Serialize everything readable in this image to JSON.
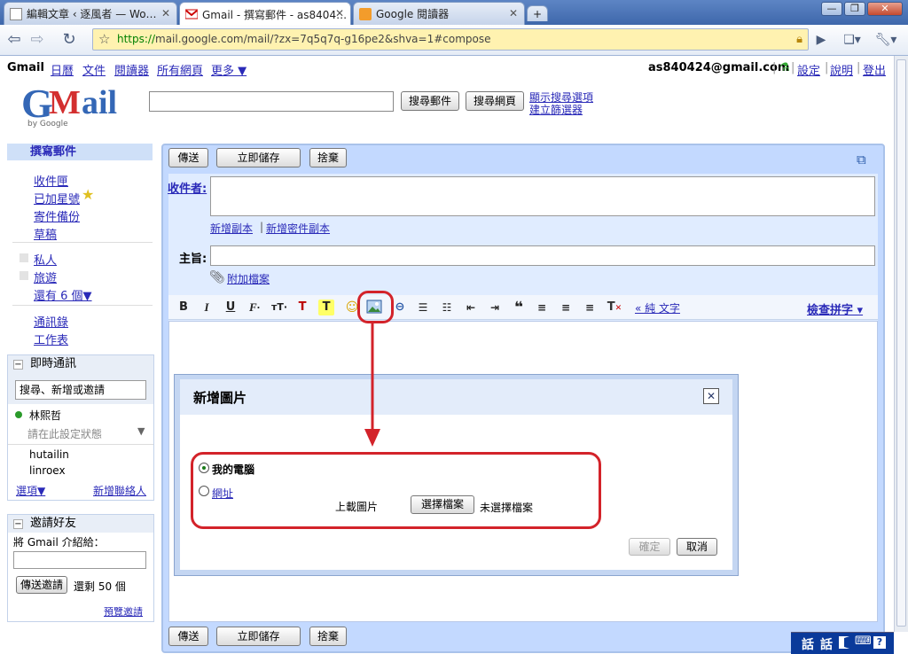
{
  "browser": {
    "tabs": [
      {
        "title": "編輯文章 ‹ 逐風者 — Wo…",
        "active": false
      },
      {
        "title": "Gmail - 撰寫郵件 - as8404…",
        "active": true
      },
      {
        "title": "Google 閱讀器",
        "active": false
      }
    ],
    "new_tab": "+",
    "window_buttons": [
      "—",
      "❐",
      "✕"
    ],
    "url_scheme": "https://",
    "url_rest": "mail.google.com/mail/?zx=7q5q7q-g16pe2&shva=1#compose"
  },
  "gmail": {
    "topnav": [
      "Gmail",
      "日曆",
      "文件",
      "閱讀器",
      "所有網頁",
      "更多 ▼"
    ],
    "account": "as840424@gmail.com",
    "account_links": [
      "設定",
      "說明",
      "登出"
    ],
    "logo": {
      "G": "G",
      "m": "M",
      "ail": "ail",
      "by": "by Google"
    },
    "search_mail": "搜尋郵件",
    "search_web": "搜尋網頁",
    "search_options": "顯示搜尋選項",
    "create_filter": "建立篩選器"
  },
  "sidebar": {
    "compose": "撰寫郵件",
    "folders": [
      "收件匣",
      "已加星號",
      "寄件備份",
      "草稿"
    ],
    "labels": [
      "私人",
      "旅遊"
    ],
    "more_labels": "還有 6 個▼",
    "contacts": "通訊錄",
    "tasks": "工作表",
    "chat": {
      "title": "即時通訊",
      "search_placeholder": "搜尋、新增或邀請",
      "me": "林熙哲",
      "status": "請在此設定狀態",
      "contacts": [
        "hutailin",
        "linroex"
      ],
      "options": "選項▼",
      "add_contact": "新增聯絡人"
    },
    "invite": {
      "title": "邀請好友",
      "prompt": "將 Gmail 介紹給：",
      "send_button": "傳送邀請",
      "remaining": "還剩 50 個",
      "preview": "預覽邀請"
    }
  },
  "compose": {
    "send": "傳送",
    "save_now": "立即儲存",
    "discard": "捨棄",
    "to_label": "收件者:",
    "add_cc": "新增副本",
    "add_bcc": "新增密件副本",
    "subject_label": "主旨:",
    "attach": "附加檔案",
    "plain_text": "« 純 文字",
    "spellcheck": "檢查拼字 ▾"
  },
  "dialog": {
    "title": "新增圖片",
    "close": "✕",
    "option_computer": "我的電腦",
    "option_url": "網址",
    "upload_label": "上載圖片",
    "choose_file": "選擇檔案",
    "no_file": "未選擇檔案",
    "ok": "確定",
    "cancel": "取消"
  },
  "tray": [
    "話",
    "話"
  ],
  "colors": {
    "accent": "#d3232a",
    "link": "#2a2ab8",
    "compose_bg": "#c3d9ff"
  }
}
